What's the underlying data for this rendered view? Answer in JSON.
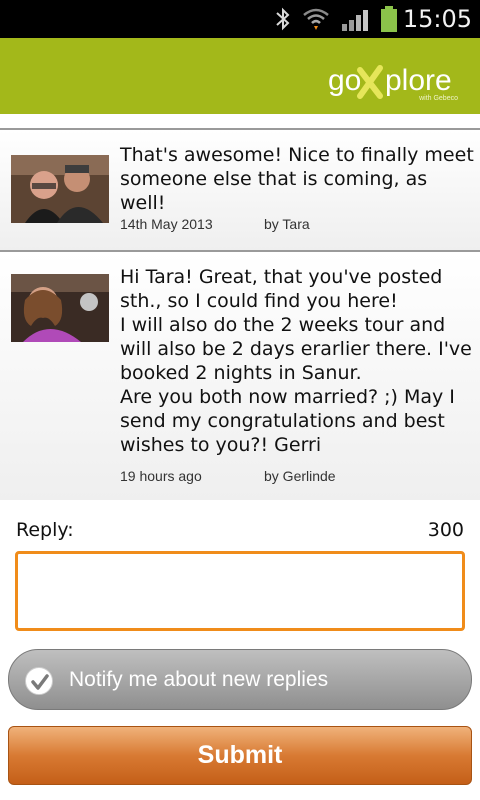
{
  "status_bar": {
    "time": "15:05",
    "icons": [
      "bluetooth-icon",
      "wifi-icon",
      "signal-icon",
      "battery-icon"
    ]
  },
  "app": {
    "logo_text": "goXplore",
    "logo_tagline": "with Gebeco",
    "brand_color": "#a3b81a"
  },
  "posts": [
    {
      "message": "That's awesome!  Nice to finally meet someone else that is coming, as well!",
      "date": "14th May 2013",
      "author": "by Tara"
    },
    {
      "message": "Hi Tara! Great, that you've posted sth., so I could find you here!\nI will also do the 2 weeks tour and will also be 2 days erarlier there. I've booked 2 nights in Sanur.\nAre you both now married? ;) May I send my congratulations and best wishes to you?!  Gerri",
      "date": "19 hours ago",
      "author": "by Gerlinde"
    }
  ],
  "reply": {
    "label": "Reply:",
    "remaining": "300",
    "value": ""
  },
  "notify": {
    "label": "Notify me about new replies",
    "checked": true
  },
  "submit": {
    "label": "Submit"
  },
  "colors": {
    "accent": "#f08c1a",
    "submit": "#d87a33"
  }
}
